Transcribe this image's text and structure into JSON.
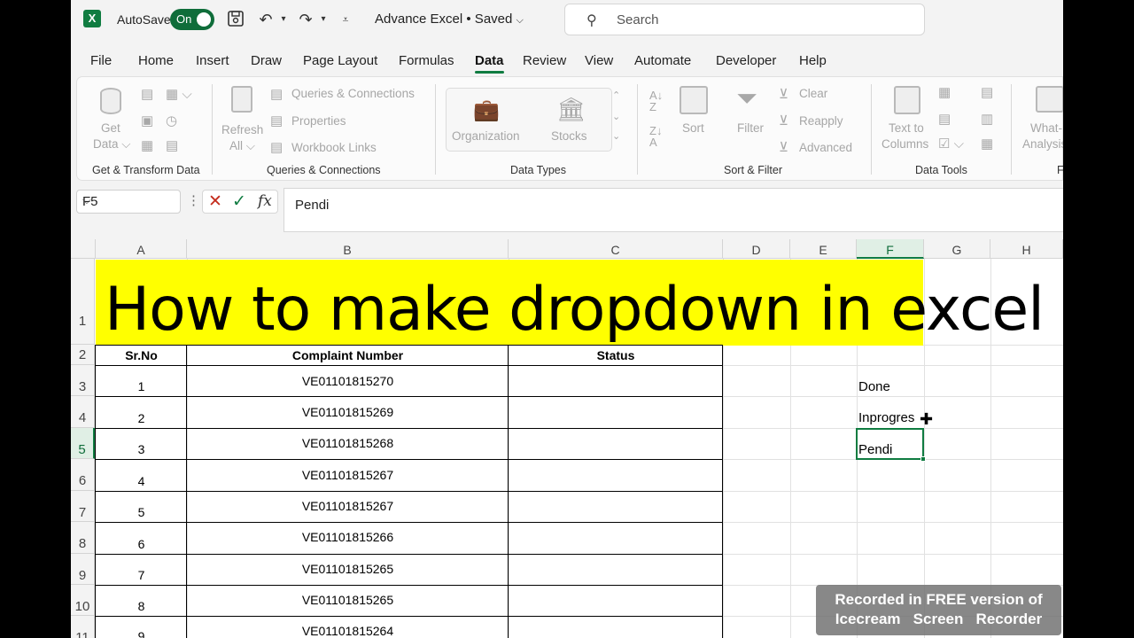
{
  "titlebar": {
    "logo": "X",
    "autosave_label": "AutoSave",
    "autosave_state": "On",
    "doc_title": "Advance Excel • Saved",
    "search_placeholder": "Search"
  },
  "menu": [
    "File",
    "Home",
    "Insert",
    "Draw",
    "Page Layout",
    "Formulas",
    "Data",
    "Review",
    "View",
    "Automate",
    "Developer",
    "Help"
  ],
  "menu_active": "Data",
  "ribbon": {
    "get_data": "Get",
    "get_data2": "Data",
    "group_get_transform": "Get & Transform Data",
    "refresh": "Refresh",
    "refresh2": "All",
    "queries_connections": "Queries & Connections",
    "properties": "Properties",
    "workbook_links": "Workbook Links",
    "group_queries": "Queries & Connections",
    "organization": "Organization",
    "stocks": "Stocks",
    "group_data_types": "Data Types",
    "sort": "Sort",
    "filter": "Filter",
    "clear": "Clear",
    "reapply": "Reapply",
    "advanced": "Advanced",
    "group_sort_filter": "Sort & Filter",
    "text_to": "Text to",
    "columns": "Columns",
    "group_data_tools": "Data Tools",
    "what_if": "What-",
    "analysis": "Analysis",
    "group_fo": "Fo"
  },
  "formula_bar": {
    "name_box": "F5",
    "fx": "fx",
    "content": "Pendi"
  },
  "columns": [
    "A",
    "B",
    "C",
    "D",
    "E",
    "F",
    "G",
    "H"
  ],
  "rows": [
    "1",
    "2",
    "3",
    "4",
    "5",
    "6",
    "7",
    "8",
    "9",
    "10",
    "11"
  ],
  "banner": "How to make dropdown in excel",
  "table": {
    "headers": [
      "Sr.No",
      "Complaint Number",
      "Status"
    ],
    "rows": [
      [
        "1",
        "VE01101815270",
        ""
      ],
      [
        "2",
        "VE01101815269",
        ""
      ],
      [
        "3",
        "VE01101815268",
        ""
      ],
      [
        "4",
        "VE01101815267",
        ""
      ],
      [
        "5",
        "VE01101815267",
        ""
      ],
      [
        "6",
        "VE01101815266",
        ""
      ],
      [
        "7",
        "VE01101815265",
        ""
      ],
      [
        "8",
        "VE01101815265",
        ""
      ],
      [
        "9",
        "VE01101815264",
        ""
      ]
    ]
  },
  "list_f": [
    "Done",
    "Inprogres",
    "Pendi"
  ],
  "watermark": {
    "line1": "Recorded in FREE version of",
    "line2": "Icecream   Screen   Recorder"
  }
}
